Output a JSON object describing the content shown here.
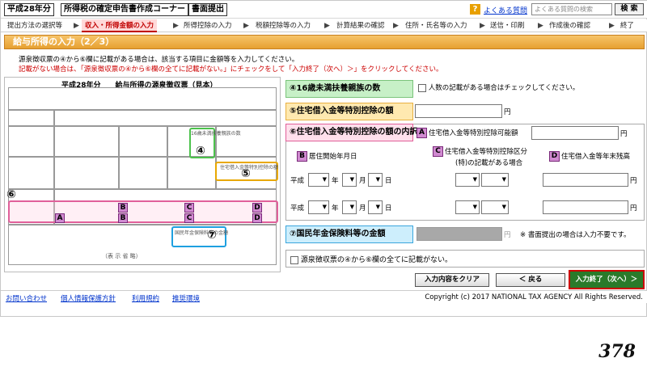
{
  "header": {
    "year_label": "平成28年分",
    "corner_label": "所得税の確定申告書作成コーナー",
    "submit_label": "書面提出",
    "help_icon": "?",
    "faq_link": "よくある質問",
    "search_placeholder": "よくある質問の検索",
    "search_button": "検 索"
  },
  "steps": [
    {
      "label": "提出方法の選択等"
    },
    {
      "label": "収入・所得金額の入力"
    },
    {
      "label": "所得控除の入力"
    },
    {
      "label": "税額控除等の入力"
    },
    {
      "label": "計算結果の確認"
    },
    {
      "label": "住所・氏名等の入力"
    },
    {
      "label": "送信・印刷"
    },
    {
      "label": "作成後の確認"
    },
    {
      "label": "終了"
    }
  ],
  "step_arrow": "▶",
  "page_title": "給与所得の入力（2／3）",
  "instructions": {
    "line1": "源泉徴収票の④から⑥欄に記載がある場合は、該当する項目に金額等を入力してください。",
    "line2": "記載がない場合は、「源泉徴収票の④から⑥欄の全てに記載がない。」にチェックをして「入力終了（次へ）＞」をクリックしてください。"
  },
  "slip": {
    "title": "平成28年分　　給与所得の源泉徴収票（見本）",
    "marker4": "④",
    "marker5": "⑤",
    "marker6": "⑥",
    "marker7": "⑦",
    "dependents_label": "16歳未満扶養親族の数",
    "housing_label": "住宅借入金等特別控除の額",
    "pension_label": "国民年金保険料等の金額",
    "letter_a": "A",
    "letter_b": "B",
    "letter_c": "C",
    "letter_d": "D",
    "bottom_caption": "（表 示 省 略）"
  },
  "form": {
    "sec4": {
      "num": "④",
      "label": "16歳未満扶養親族の数",
      "checkbox_label": "人数の記載がある場合はチェックしてください。"
    },
    "sec5": {
      "num": "⑤",
      "label": "住宅借入金等特別控除の額",
      "unit": "円"
    },
    "sec6": {
      "num": "⑥",
      "label": "住宅借入金等特別控除の額の内訳",
      "a_label": "住宅借入金等特別控除可能額",
      "a_unit": "円",
      "b_label": "居住開始年月日",
      "c_label": "住宅借入金等特別控除区分",
      "c_sub": "(特)の記載がある場合",
      "d_label": "住宅借入金等年末残高",
      "row1": {
        "era": "平成",
        "year_unit": "年",
        "month_unit": "月",
        "day_unit": "日",
        "d_unit": "円"
      },
      "row2": {
        "era": "平成",
        "year_unit": "年",
        "month_unit": "月",
        "day_unit": "日",
        "d_unit": "円"
      }
    },
    "sec7": {
      "num": "⑦",
      "label": "国民年金保険料等の金額",
      "unit": "円",
      "note": "※ 書面提出の場合は入力不要です。"
    },
    "none_checkbox_label": "源泉徴収票の④から⑥欄の全てに記載がない。"
  },
  "buttons": {
    "clear": "入力内容をクリア",
    "back": "＜ 戻る",
    "next": "入力終了（次へ）＞"
  },
  "footer": {
    "links": [
      "お問い合わせ",
      "個人情報保護方針",
      "利用規約",
      "推奨環境"
    ],
    "copyright": "Copyright (c) 2017 NATIONAL TAX AGENCY All Rights Reserved."
  },
  "page_number": "378",
  "colors": {
    "accent": "#e7a030",
    "active_step": "#c00000",
    "sec4": "#c7f0c7",
    "sec5": "#ffe9b0",
    "sec6": "#ffe0ec",
    "sec7": "#cdeefc",
    "next_border": "#cc0000"
  }
}
